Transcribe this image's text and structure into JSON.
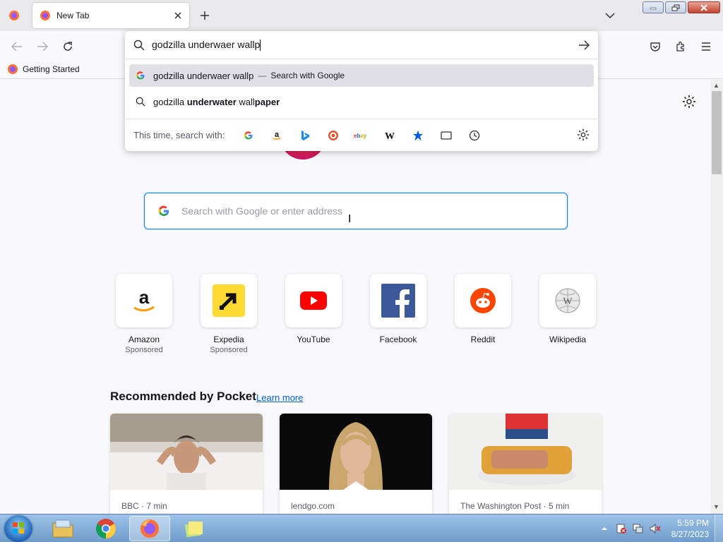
{
  "browser": {
    "tab": {
      "title": "New Tab"
    },
    "bookmarks": [
      {
        "label": "Getting Started"
      }
    ]
  },
  "urlbar": {
    "query": "godzilla underwaer wallp",
    "results": [
      {
        "text": "godzilla underwaer wallp",
        "separator": "—",
        "action": "Search with Google"
      },
      {
        "prefix": "godzilla ",
        "bold1": "underwater",
        "mid": " wall",
        "bold2": "paper"
      }
    ],
    "oneoff_label": "This time, search with:",
    "engines": [
      "google-icon",
      "amazon-icon",
      "bing-icon",
      "duckduckgo-icon",
      "ebay-icon",
      "wikipedia-icon",
      "bookmarks-icon",
      "tabs-icon",
      "history-icon"
    ]
  },
  "newtab": {
    "search_placeholder": "Search with Google or enter address",
    "top_sites": [
      {
        "name": "Amazon",
        "sponsor": "Sponsored"
      },
      {
        "name": "Expedia",
        "sponsor": "Sponsored"
      },
      {
        "name": "YouTube",
        "sponsor": ""
      },
      {
        "name": "Facebook",
        "sponsor": ""
      },
      {
        "name": "Reddit",
        "sponsor": ""
      },
      {
        "name": "Wikipedia",
        "sponsor": ""
      }
    ],
    "pocket": {
      "heading": "Recommended by Pocket",
      "learn_more": "Learn more",
      "cards": [
        {
          "source": "BBC · 7 min"
        },
        {
          "source": "lendgo.com"
        },
        {
          "source": "The Washington Post · 5 min"
        }
      ]
    }
  },
  "taskbar": {
    "time": "5:59 PM",
    "date": "8/27/2023"
  },
  "colors": {
    "accent": "#0a84ff",
    "link": "#0061e0",
    "selected_row": "#e0e0e6"
  }
}
